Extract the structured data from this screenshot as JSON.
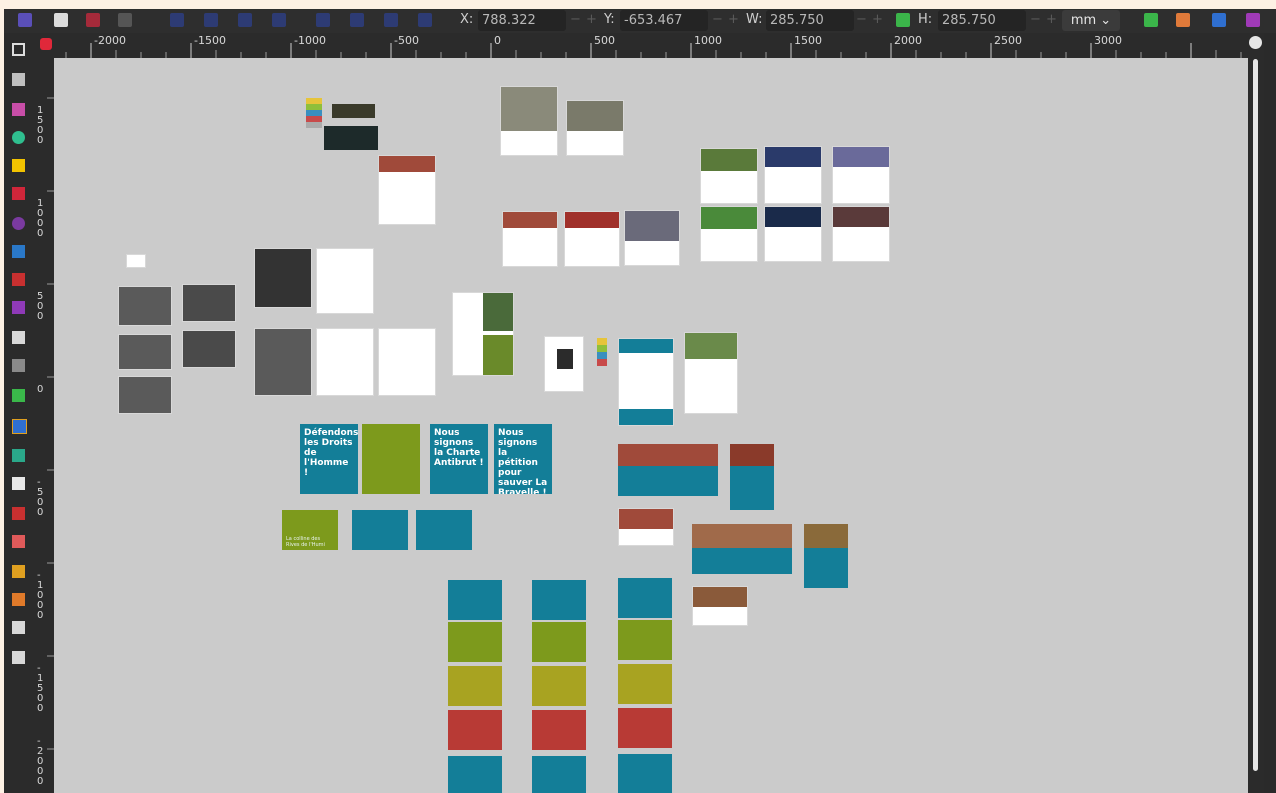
{
  "toolbar": {
    "x_label": "X:",
    "x_value": "788.322",
    "y_label": "Y:",
    "y_value": "-653.467",
    "w_label": "W:",
    "w_value": "285.750",
    "h_label": "H:",
    "h_value": "285.750",
    "unit": "mm",
    "unit_chevron": "⌄",
    "minus": "−",
    "plus": "+"
  },
  "ruler": {
    "h_labels": [
      "-2000",
      "-1500",
      "-1000",
      "-500",
      "0",
      "500",
      "1000",
      "1500",
      "2000",
      "2500",
      "3000"
    ],
    "v_labels": [
      "1500",
      "1000",
      "500",
      "0",
      "-500",
      "-1000",
      "-1500",
      "-2000"
    ]
  },
  "canvas": {
    "teal_card_headings": [
      "Défendons les Droits de l'Homme !",
      "Nous signons la Charte Antibrut !",
      "Nous signons la pétition pour sauver La Brayelle !"
    ],
    "green_card_heading": "La colline des Rives de l'Humi",
    "colors": {
      "teal": "#137e98",
      "olive": "#7d9a1c",
      "mustard": "#a8a321",
      "red": "#b83a35",
      "canvas": "#cbcbcb",
      "chrome": "#2b2b2b"
    }
  }
}
